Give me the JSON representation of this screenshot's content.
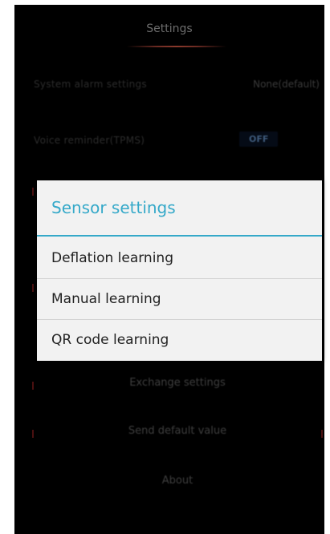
{
  "settings": {
    "title": "Settings",
    "rows": [
      {
        "label": "System alarm settings",
        "value": "None(default)"
      },
      {
        "label": "Voice reminder(TPMS)",
        "value": "OFF"
      }
    ],
    "items": [
      {
        "label": "Exchange settings"
      },
      {
        "label": "Send default value"
      },
      {
        "label": "About"
      }
    ]
  },
  "dialog": {
    "title": "Sensor settings",
    "options": [
      {
        "label": "Deflation learning"
      },
      {
        "label": "Manual learning"
      },
      {
        "label": "QR code learning"
      }
    ]
  },
  "colors": {
    "accent": "#35a9c9",
    "dialog_background": "#f2f2f2",
    "screen_background": "#000000"
  }
}
